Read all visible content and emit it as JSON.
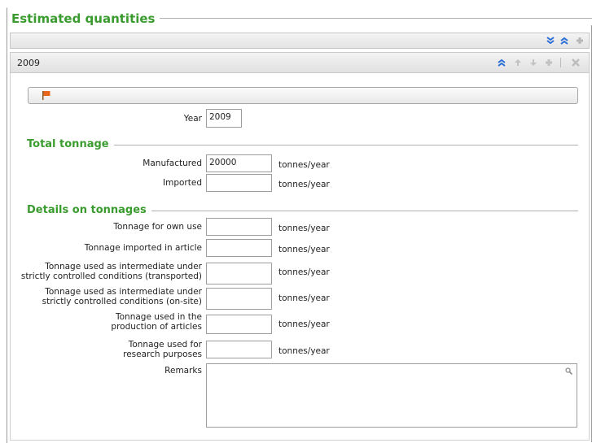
{
  "panel": {
    "title": "Estimated quantities"
  },
  "block": {
    "title": "2009"
  },
  "year": {
    "label": "Year",
    "value": "2009"
  },
  "total_tonnage": {
    "title": "Total tonnage",
    "manufactured": {
      "label": "Manufactured",
      "value": "20000",
      "unit": "tonnes/year"
    },
    "imported": {
      "label": "Imported",
      "value": "",
      "unit": "tonnes/year"
    }
  },
  "details": {
    "title": "Details on tonnages",
    "own_use": {
      "label": "Tonnage for own use",
      "value": "",
      "unit": "tonnes/year"
    },
    "imported_in_article": {
      "label": "Tonnage imported in article",
      "value": "",
      "unit": "tonnes/year"
    },
    "intermediate_transported": {
      "label_line1": "Tonnage used as intermediate under",
      "label_line2": "strictly controlled conditions (transported)",
      "value": "",
      "unit": "tonnes/year"
    },
    "intermediate_onsite": {
      "label_line1": "Tonnage used as intermediate under",
      "label_line2": "strictly controlled conditions (on-site)",
      "value": "",
      "unit": "tonnes/year"
    },
    "production_of_articles": {
      "label_line1": "Tonnage used in the",
      "label_line2": "production of articles",
      "value": "",
      "unit": "tonnes/year"
    },
    "research": {
      "label_line1": "Tonnage used for",
      "label_line2": "research purposes",
      "value": "",
      "unit": "tonnes/year"
    },
    "remarks": {
      "label": "Remarks",
      "value": ""
    }
  },
  "icons": {
    "expand_all": "double-chevron-down-icon",
    "collapse_all": "double-chevron-up-icon",
    "add": "plus-icon",
    "block_collapse": "double-chevron-up-icon",
    "move_up": "arrow-up-icon",
    "move_down": "arrow-down-icon",
    "block_add": "plus-icon",
    "delete": "close-icon",
    "flag": "flag-icon",
    "search": "search-icon"
  },
  "colors": {
    "section_title": "#3a9b2e",
    "icon_active": "#2a6fd6",
    "icon_disabled": "#b8b8b8",
    "flag": "#e8671d"
  }
}
